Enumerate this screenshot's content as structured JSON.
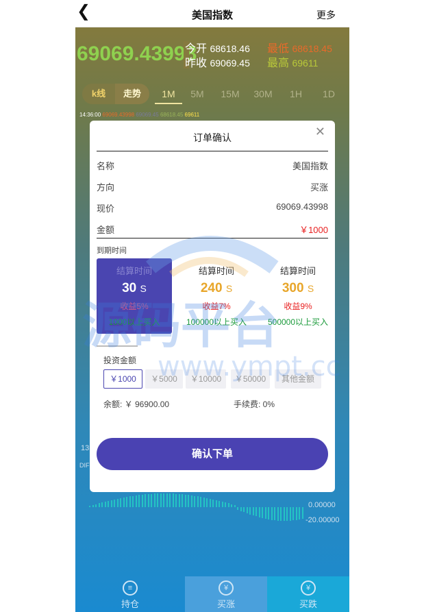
{
  "header": {
    "back_icon": "chevron-left-icon",
    "title": "美国指数",
    "more": "更多"
  },
  "quote": {
    "price": "69069.43998",
    "open_label": "今开",
    "open_value": "68618.46",
    "prev_close_label": "昨收",
    "prev_close_value": "69069.45",
    "low_label": "最低",
    "low_value": "68618.45",
    "high_label": "最高",
    "high_value": "69611"
  },
  "tabs": [
    {
      "label": "k线"
    },
    {
      "label": "走势"
    },
    {
      "label": "1M"
    },
    {
      "label": "5M"
    },
    {
      "label": "15M"
    },
    {
      "label": "30M"
    },
    {
      "label": "1H"
    },
    {
      "label": "1D"
    }
  ],
  "ticker": {
    "time": "14:36:00",
    "v1": "69069.43998",
    "v2": "69069.45",
    "v3": "68618.45",
    "v4": "69611"
  },
  "chart_axis": {
    "l1": "13",
    "l2": "DIF",
    "r1": "0.00000",
    "r2": "-20.00000"
  },
  "bottom_nav": [
    {
      "label": "持仓",
      "icon": "coins-icon"
    },
    {
      "label": "买涨",
      "icon": "yen-up-icon"
    },
    {
      "label": "买跌",
      "icon": "yen-down-icon"
    }
  ],
  "modal": {
    "title": "订单确认",
    "close_icon": "close-icon",
    "rows": [
      {
        "label": "名称",
        "value": "美国指数"
      },
      {
        "label": "方向",
        "value": "买涨"
      },
      {
        "label": "现价",
        "value": "69069.43998"
      },
      {
        "label": "金额",
        "value": "￥1000"
      }
    ],
    "expire_label": "到期时间",
    "cards": [
      {
        "title": "结算时间",
        "seconds": "30",
        "unit": "S",
        "profit": "收益5%",
        "min": "1000以上买入"
      },
      {
        "title": "结算时间",
        "seconds": "240",
        "unit": "S",
        "profit": "收益7%",
        "min": "100000以上买入"
      },
      {
        "title": "结算时间",
        "seconds": "300",
        "unit": "S",
        "profit": "收益9%",
        "min": "500000以上买入"
      }
    ],
    "invest_label": "投资金额",
    "amounts": [
      "￥1000",
      "￥5000",
      "￥10000",
      "￥50000",
      "其他金额"
    ],
    "balance": "余额: ￥ 96900.00",
    "fee": "手续费: 0%",
    "confirm": "确认下单"
  },
  "watermark": {
    "text": "源码平台",
    "url": "www.ympt.cc"
  }
}
